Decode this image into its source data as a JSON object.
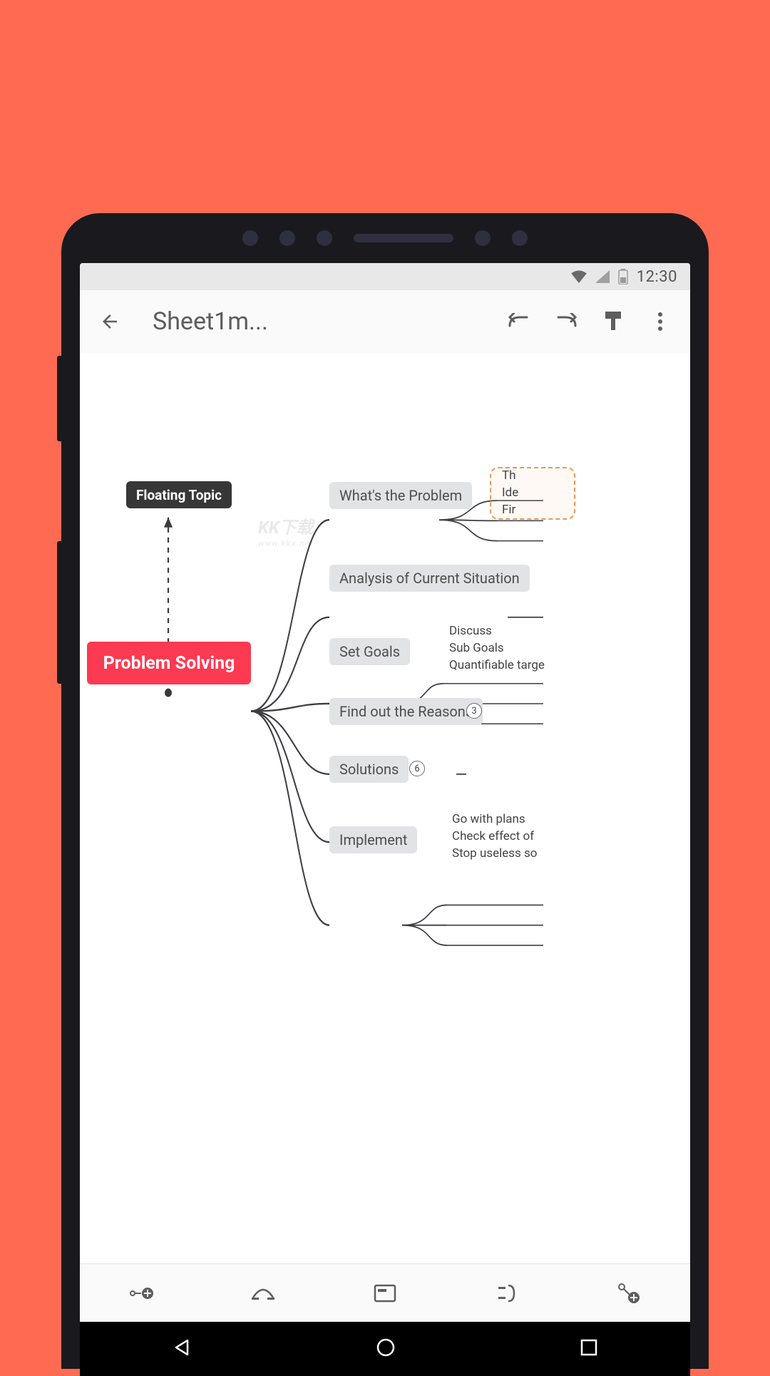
{
  "status": {
    "time": "12:30"
  },
  "appbar": {
    "title": "Sheet1m..."
  },
  "watermark": {
    "line1": "KK下载",
    "line2": "www.kkx.net"
  },
  "mindmap": {
    "central": "Problem Solving",
    "floating": "Floating Topic",
    "branches": [
      {
        "label": "What's the Problem",
        "subs": [
          "Th",
          "Ide",
          "Fir"
        ],
        "boundary": true
      },
      {
        "label": "Analysis of Current Situation",
        "subs": []
      },
      {
        "label": "Set Goals",
        "subs": [
          "Discuss",
          "Sub Goals",
          "Quantifiable targe"
        ]
      },
      {
        "label": "Find out the Reasons",
        "badge": "3"
      },
      {
        "label": "Solutions",
        "badge": "6"
      },
      {
        "label": "Implement",
        "subs": [
          "Go with plans",
          "Check effect of",
          "Stop useless so"
        ]
      }
    ]
  }
}
